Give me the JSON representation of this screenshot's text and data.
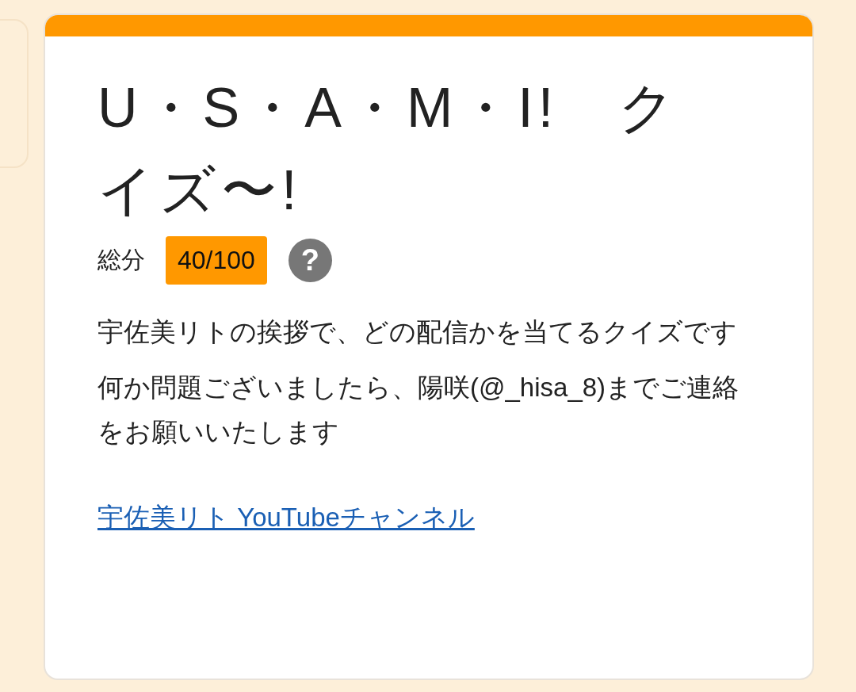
{
  "card": {
    "title": "U・S・A・M・I!　クイズ〜!",
    "score": {
      "label": "総分",
      "value": "40/100",
      "help": "?"
    },
    "description": [
      "宇佐美リトの挨拶で、どの配信かを当てるクイズです",
      "何か問題ございましたら、陽咲(@_hisa_8)までご連絡をお願いいたします"
    ],
    "link": "宇佐美リト YouTubeチャンネル"
  }
}
